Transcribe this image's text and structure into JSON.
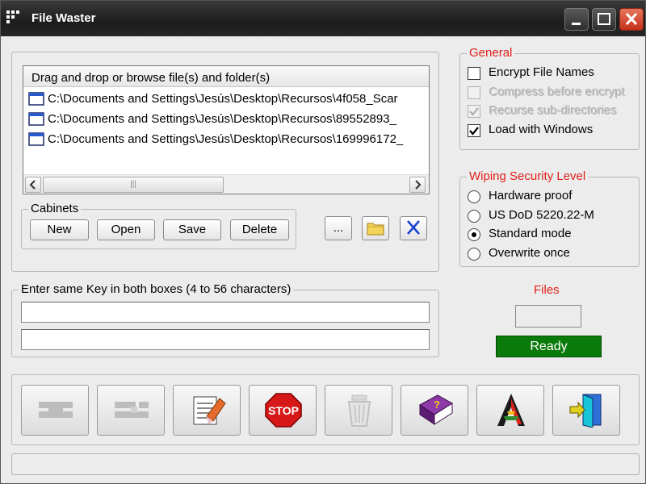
{
  "window": {
    "title": "File Waster"
  },
  "file_list": {
    "header": "Drag and drop or browse file(s) and folder(s)",
    "items": [
      "C:\\Documents and Settings\\Jesús\\Desktop\\Recursos\\4f058_Scar",
      "C:\\Documents and Settings\\Jesús\\Desktop\\Recursos\\89552893_",
      "C:\\Documents and Settings\\Jesús\\Desktop\\Recursos\\169996172_"
    ],
    "scroll_grip": "|||"
  },
  "cabinets": {
    "label": "Cabinets",
    "buttons": {
      "new": "New",
      "open": "Open",
      "save": "Save",
      "delete": "Delete"
    },
    "browse": "..."
  },
  "general": {
    "label": "General",
    "options": [
      {
        "label": "Encrypt File Names",
        "checked": false,
        "enabled": true
      },
      {
        "label": "Compress before encrypt",
        "checked": false,
        "enabled": false
      },
      {
        "label": "Recurse sub-directories",
        "checked": true,
        "enabled": false
      },
      {
        "label": "Load with Windows",
        "checked": true,
        "enabled": true
      }
    ]
  },
  "wiping": {
    "label": "Wiping Security Level",
    "options": [
      {
        "label": "Hardware proof",
        "selected": false
      },
      {
        "label": "US DoD 5220.22-M",
        "selected": false
      },
      {
        "label": "Standard mode",
        "selected": true
      },
      {
        "label": "Overwrite once",
        "selected": false
      }
    ]
  },
  "key": {
    "label": "Enter same Key in both boxes (4 to 56 characters)",
    "value1": "",
    "value2": ""
  },
  "files": {
    "label": "Files",
    "count": "",
    "status": "Ready"
  },
  "colors": {
    "accent": "#e0201a",
    "status_bg": "#0a7a0a",
    "title_bg": "#262626"
  },
  "toolbar_icons": [
    "encrypt-icon",
    "decrypt-icon",
    "wipe-icon",
    "stop-icon",
    "recycle-bin-icon",
    "help-book-icon",
    "about-icon",
    "exit-icon"
  ]
}
